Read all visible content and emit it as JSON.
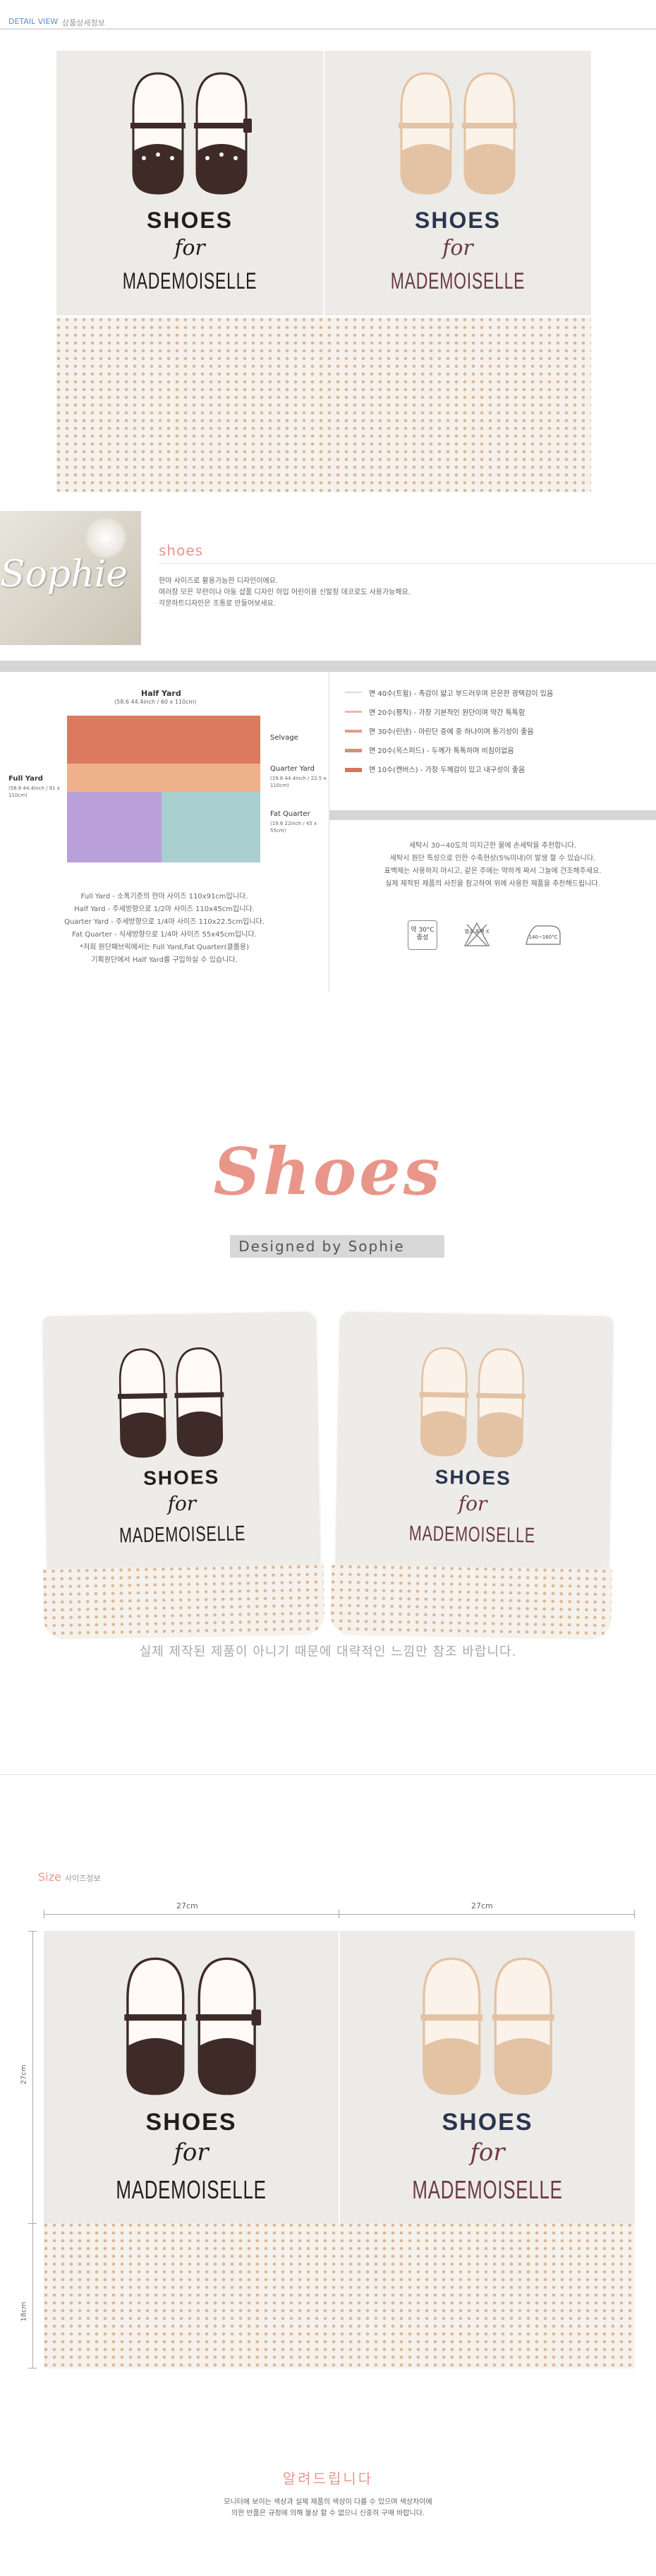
{
  "header": {
    "view_label": "DETAIL VIEW",
    "info_label": "상품상세정보"
  },
  "product": {
    "line1": "SHOES",
    "line2": "for",
    "line3": "MADEMOISELLE"
  },
  "designer": {
    "name_logo": "Sophie",
    "title": "shoes",
    "desc": [
      "한마 사이즈로 활용가능한 디자인이에요.",
      "여러장 모은 무란이나 아동 샵품 디자인 하입 어린이용 신발장 데코로도 사용가능해요.",
      "각문하트디자인은 조통로 만들어보세요."
    ]
  },
  "fabric_size": {
    "half_yard_label": "Half Yard",
    "half_yard_dims": "(58.6 44.4inch / 60 x 110cm)",
    "selvage": "Selvage",
    "full_yard_label": "Full Yard",
    "full_yard_dims": "(58.6 44.4inch / 91 x 110cm)",
    "quarter_yard_label": "Quarter Yard",
    "quarter_yard_dims": "(19.6 44.4inch / 22.5 x 110cm)",
    "fat_quarter_label": "Fat Quarter",
    "fat_quarter_dims": "(19.6 22inch / 45 x 55cm)",
    "notes": [
      "Full Yard - 소폭기준의 한마 사이즈 110x91cm입니다.",
      "Half Yard - 주세방향으로 1/2마 사이즈 110x45cm입니다.",
      "Quarter Yard - 주세방향으로 1/4마 사이즈 110x22.5cm입니다.",
      "Fat Quarter - 식세방향으로 1/4마 사이즈 55x45cm입니다.",
      "*저희 원단패브릭에서는 Full Yard,Fat Quarter(클롭용)",
      "기획원단에서 Half Yard를 구입하실 수 있습니다."
    ]
  },
  "fabric_types": [
    {
      "label": "면 40수(트윌) - 촉감이 얇고 부드러우며 은은한 광택감이 있음",
      "color": "#d9d9d9"
    },
    {
      "label": "면 20수(평직) - 가장 기본적인 원단이며 약간 톡톡함",
      "color": "#e9b8ac"
    },
    {
      "label": "면 30수(린넨) - 마린단 중에 중 하나이며 통기성이 좋음",
      "color": "#e39a88"
    },
    {
      "label": "면 20수(옥스퍼드) - 두께가 톡톡하며 비침이없음",
      "color": "#de8a78"
    },
    {
      "label": "면 10수(캔버스) - 가장 두께감이 있고 내구성이 좋음",
      "color": "#d9735e"
    }
  ],
  "care": {
    "text": [
      "세탁시 30~40도의 미지근한 물에 손세탁을 추천합니다.",
      "세탁시 원단 특성으로 인한 수축현상(5%미내)이 발생 할 수 있습니다.",
      "표백제는 사용하지 마시고, 같은 주에는 약하게 짜서 그늘에 건조해주세요.",
      "실제 제작된 제품의 사진을 참고하여 위에 사용한 제품을 추천해드립니다."
    ],
    "icons": [
      {
        "label": "약 30°C 중성",
        "name": "wash-icon"
      },
      {
        "label": "염소 표백 X",
        "name": "no-bleach-icon"
      },
      {
        "label": "140~160°C",
        "name": "iron-icon"
      }
    ]
  },
  "hero": {
    "title": "Shoes",
    "subtitle": "Designed by Sophie"
  },
  "notice": "실제 제작된 제품이 아니기 때문에 대략적인 느낌만 참조 바랍니다.",
  "size": {
    "label": "Size",
    "sub": "사이즈정보",
    "width_left": "27cm",
    "width_right": "27cm",
    "height_top": "27cm",
    "height_bottom": "18cm"
  },
  "footer": {
    "title": "알려드립니다",
    "lines": [
      "모니터에 보이는 색상과 실제 제품의 색상이 다를 수 있으며 색상차이에",
      "의한 반품은 규정에 의해 불상 할 수 없으니 신중히 구매 바랍니다."
    ]
  },
  "colors": {
    "accent": "#e9968a",
    "dark_shoe": "#3e2a26",
    "light_shoe": "#e3c3a4",
    "navy_text": "#2b3550",
    "mauve_text": "#6b3a4a"
  }
}
